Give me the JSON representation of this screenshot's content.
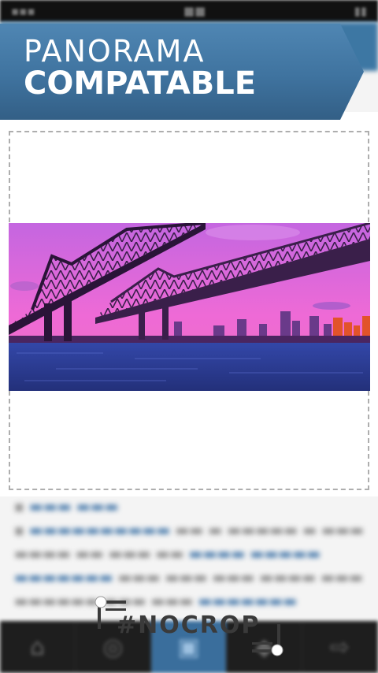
{
  "banner": {
    "line1": "PANORAMA",
    "line2": "COMPATABLE"
  },
  "watermark": "#NOCROP",
  "colors": {
    "banner": "#3f739f",
    "tab_active": "#3a6e9c"
  },
  "tabs": [
    {
      "icon": "home-icon"
    },
    {
      "icon": "compass-icon"
    },
    {
      "icon": "crop-icon",
      "active": true
    },
    {
      "icon": "tag-icon"
    },
    {
      "icon": "share-icon"
    }
  ],
  "photo": {
    "subject": "bridge-skyline-panorama"
  }
}
